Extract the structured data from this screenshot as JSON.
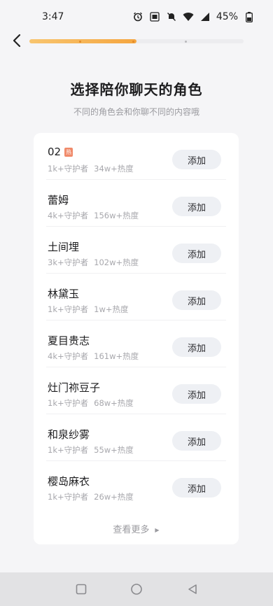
{
  "status_bar": {
    "time": "3:47",
    "battery_percent": "45%",
    "icons": [
      "alarm-icon",
      "volte-icon",
      "mute-icon",
      "wifi-icon",
      "signal-icon",
      "battery-icon"
    ]
  },
  "progress": {
    "fraction": 0.5,
    "fill_colors": [
      "#f8c56f",
      "#f5a640"
    ]
  },
  "heading": {
    "title": "选择陪你聊天的角色",
    "subtitle": "不同的角色会和你聊不同的内容哦"
  },
  "characters": [
    {
      "name": "02",
      "badge": "热",
      "guardians": "1k+守护者",
      "heat": "34w+热度",
      "button": "添加"
    },
    {
      "name": "蕾姆",
      "guardians": "4k+守护者",
      "heat": "156w+热度",
      "button": "添加"
    },
    {
      "name": "土间埋",
      "guardians": "3k+守护者",
      "heat": "102w+热度",
      "button": "添加"
    },
    {
      "name": "林黛玉",
      "guardians": "1k+守护者",
      "heat": "1w+热度",
      "button": "添加"
    },
    {
      "name": "夏目贵志",
      "guardians": "4k+守护者",
      "heat": "161w+热度",
      "button": "添加"
    },
    {
      "name": "灶门祢豆子",
      "guardians": "1k+守护者",
      "heat": "68w+热度",
      "button": "添加"
    },
    {
      "name": "和泉纱雾",
      "guardians": "1k+守护者",
      "heat": "55w+热度",
      "button": "添加"
    },
    {
      "name": "樱岛麻衣",
      "guardians": "1k+守护者",
      "heat": "26w+热度",
      "button": "添加"
    }
  ],
  "see_more": {
    "label": "查看更多"
  },
  "colors": {
    "accent": "#f5a640",
    "badge": "#f08a6a",
    "background": "#f5f5f7",
    "button_bg": "#eef0f4"
  }
}
